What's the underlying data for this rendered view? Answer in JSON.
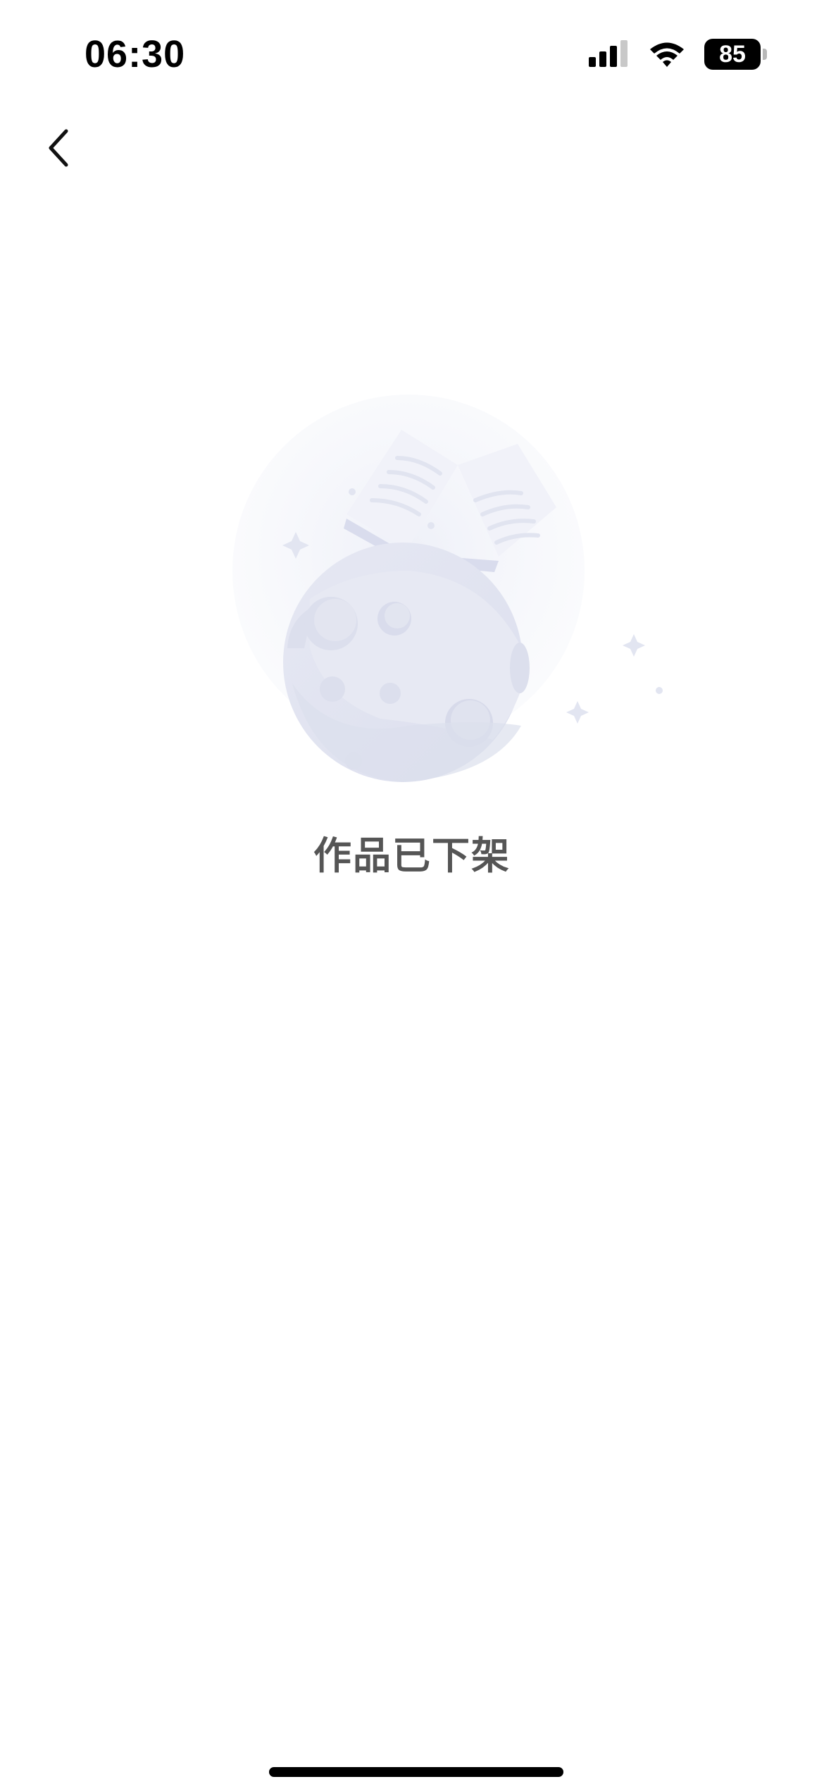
{
  "status_bar": {
    "time": "06:30",
    "battery_level": "85",
    "icons": [
      "signal-icon",
      "wifi-icon",
      "battery-icon"
    ]
  },
  "nav": {
    "back_icon": "chevron-left-icon"
  },
  "empty_state": {
    "illustration": "moon-with-book-illustration",
    "message": "作品已下架"
  },
  "colors": {
    "background": "#ffffff",
    "message_text": "#555555",
    "illustration_tint": "#e3e6f2"
  }
}
